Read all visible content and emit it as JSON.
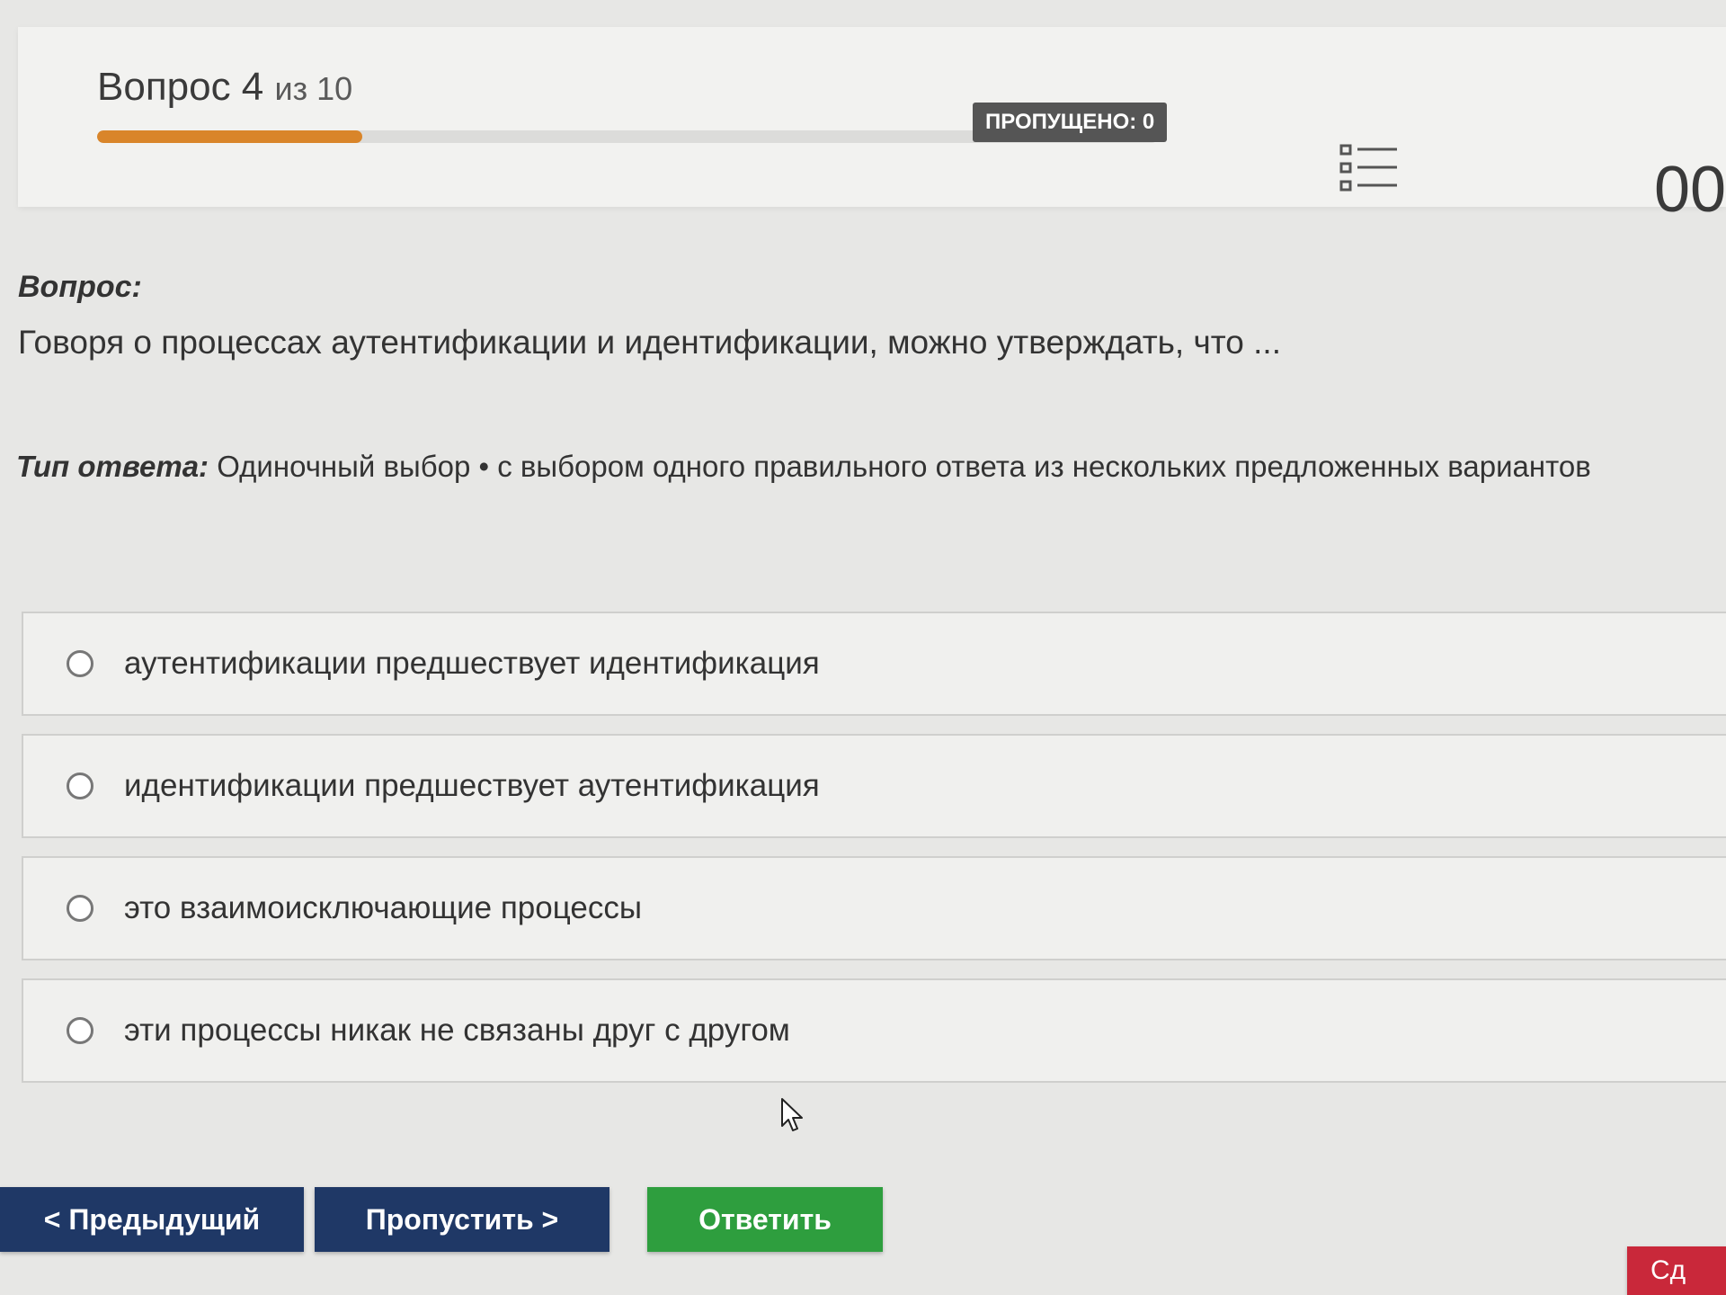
{
  "header": {
    "question_label": "Вопрос 4",
    "question_of": "из 10",
    "progress_fraction": 0.25,
    "skipped_badge": "ПРОПУЩЕНО: 0",
    "questions_list_icon": "question-list-icon",
    "timer": "00"
  },
  "question": {
    "label": "Вопрос:",
    "text": "Говоря о процессах аутентификации и идентификации, можно утверждать, что ..."
  },
  "answer_type": {
    "label": "Тип ответа:",
    "value": "Одиночный выбор • с выбором одного правильного ответа из нескольких предложенных вариантов"
  },
  "options": [
    {
      "text": "аутентификации предшествует идентификация"
    },
    {
      "text": "идентификации предшествует аутентификация"
    },
    {
      "text": "это взаимоисключающие процессы"
    },
    {
      "text": "эти процессы никак не связаны друг с другом"
    }
  ],
  "buttons": {
    "previous": "< Предыдущий",
    "skip": "Пропустить >",
    "answer": "Ответить",
    "finish": "Сд"
  },
  "colors": {
    "progress": "#d9852a",
    "nav_button": "#1f3866",
    "answer_button": "#2e9e3e",
    "finish_button": "#c9283a",
    "badge": "#555555"
  }
}
